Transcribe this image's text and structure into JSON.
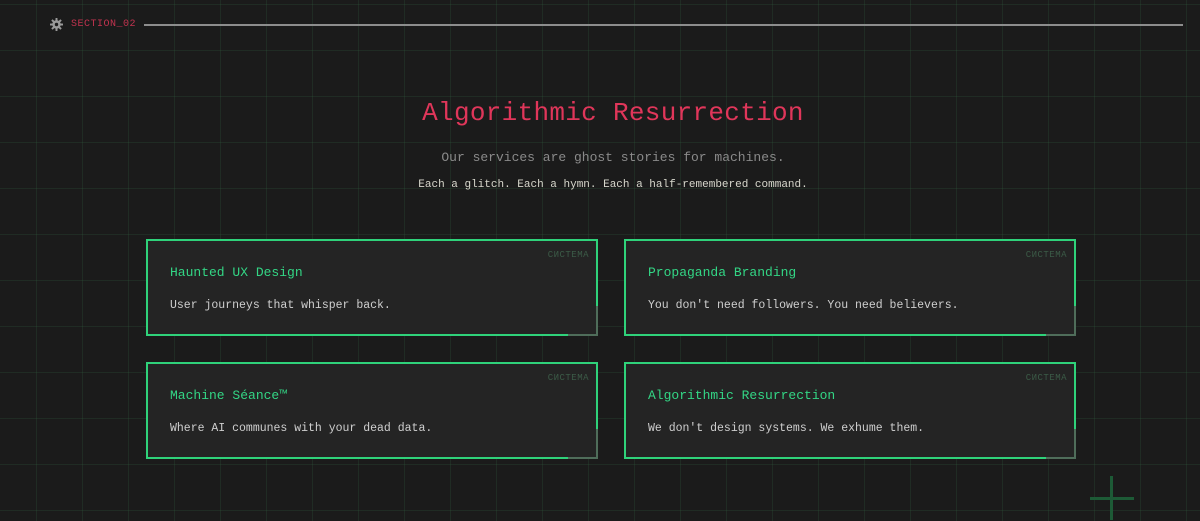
{
  "section": {
    "label": "SECTION_02",
    "icon": "gear-icon"
  },
  "header": {
    "title": "Algorithmic Resurrection",
    "subtitle": "Our services are ghost stories for machines.",
    "tagline": "Each a glitch. Each a hymn. Each a half-remembered command."
  },
  "cards": [
    {
      "tag": "СИСТЕМА",
      "title": "Haunted UX Design",
      "description": "User journeys that whisper back."
    },
    {
      "tag": "СИСТЕМА",
      "title": "Propaganda Branding",
      "description": "You don't need followers. You need believers."
    },
    {
      "tag": "СИСТЕМА",
      "title": "Machine Séance™",
      "description": "Where AI communes with your dead data."
    },
    {
      "tag": "СИСТЕМА",
      "title": "Algorithmic Resurrection",
      "description": "We don't design systems. We exhume them."
    }
  ],
  "colors": {
    "accent": "#e0365a",
    "card_border": "#2fd27a",
    "card_title": "#33d685",
    "background": "#1b1b1b"
  }
}
